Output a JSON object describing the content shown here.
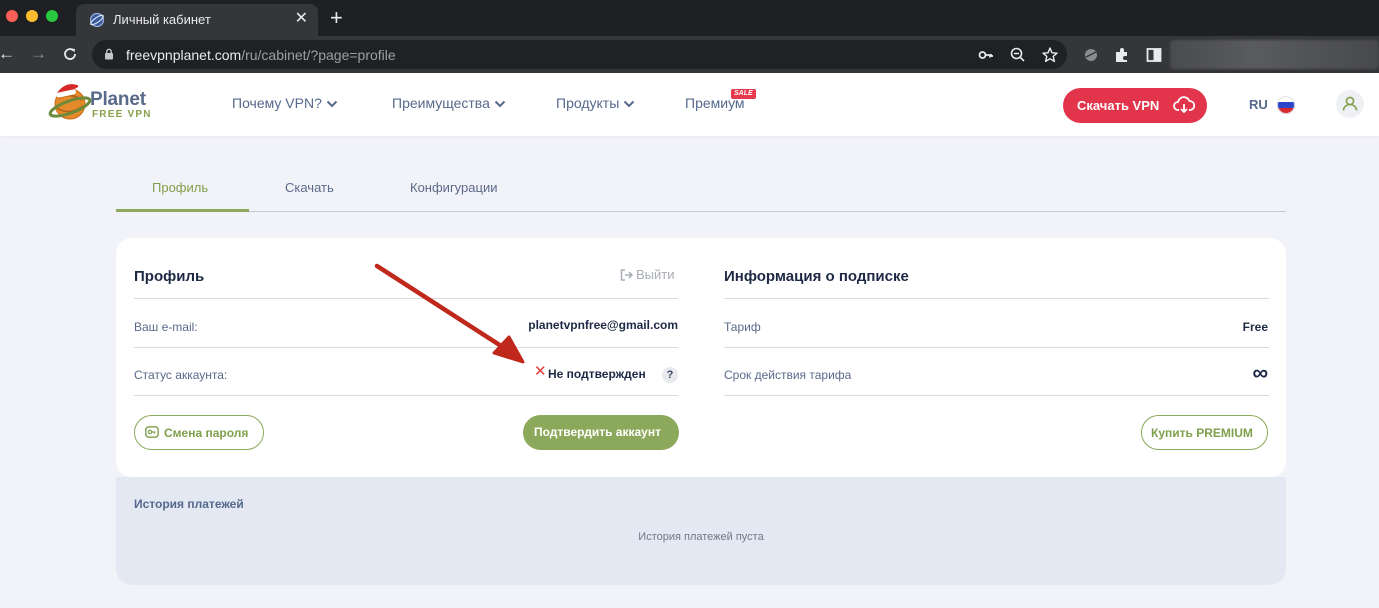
{
  "browser": {
    "tab_title": "Личный кабинет",
    "url_host": "freevpnplanet.com",
    "url_path": "/ru/cabinet/?page=profile"
  },
  "header": {
    "logo_title": "Planet",
    "logo_sub": "FREE VPN",
    "menu": [
      {
        "label": "Почему VPN?"
      },
      {
        "label": "Преимущества"
      },
      {
        "label": "Продукты"
      },
      {
        "label": "Премиум"
      }
    ],
    "sale_badge": "SALE",
    "download_label": "Скачать VPN",
    "lang": "RU"
  },
  "tabs": [
    {
      "label": "Профиль"
    },
    {
      "label": "Скачать"
    },
    {
      "label": "Конфигурации"
    }
  ],
  "profile": {
    "title": "Профиль",
    "logout": "Выйти",
    "email_label": "Ваш e-mail:",
    "email_value": "planetvpnfree@gmail.com",
    "status_label": "Статус аккаунта:",
    "status_value": "Не подтвержден",
    "help": "?",
    "change_password": "Смена пароля",
    "confirm_account": "Подтвердить аккаунт"
  },
  "subscription": {
    "title": "Информация о подписке",
    "plan_label": "Тариф",
    "plan_value": "Free",
    "expiry_label": "Срок действия тарифа",
    "expiry_value": "∞",
    "buy_premium": "Купить PREMIUM"
  },
  "payments": {
    "title": "История платежей",
    "empty": "История платежей пуста"
  },
  "colors": {
    "accent_green": "#8ca85a",
    "accent_red": "#e2344a",
    "annotation_arrow": "#c0281c"
  }
}
